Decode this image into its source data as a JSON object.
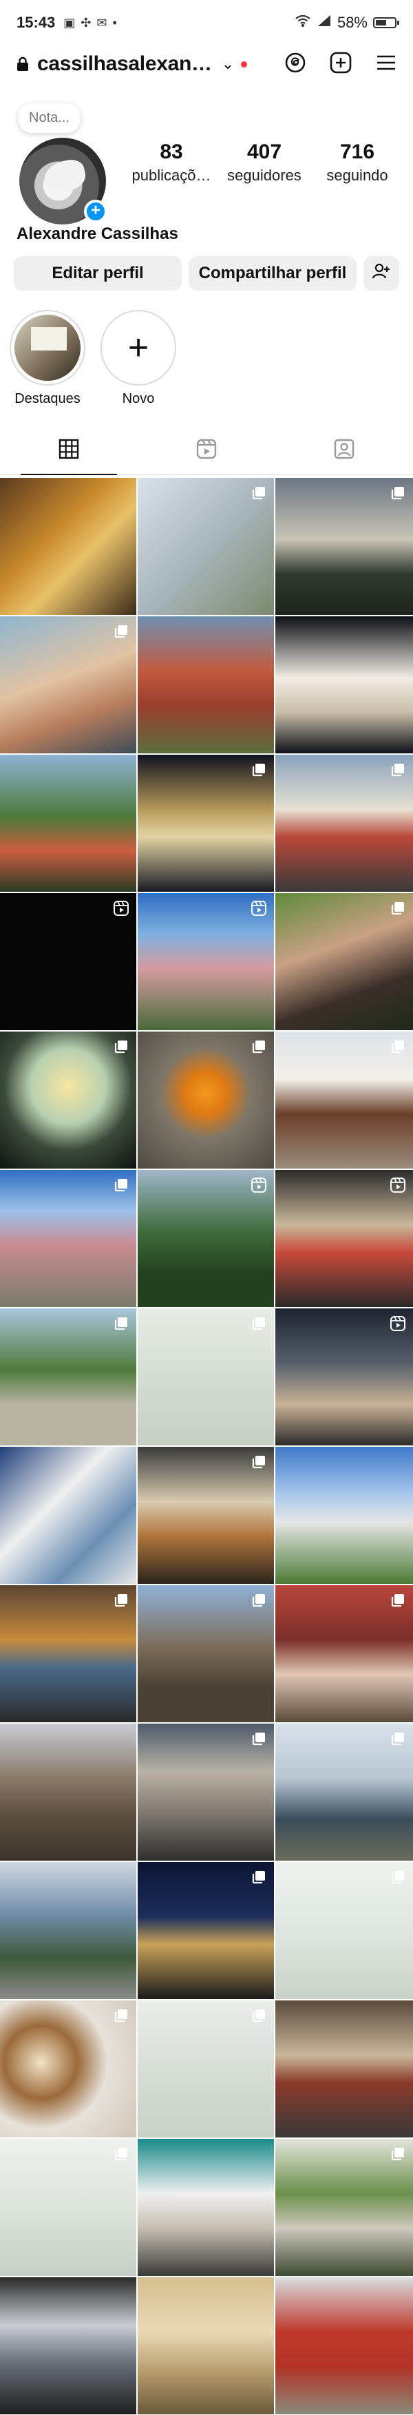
{
  "status_bar": {
    "time": "15:43",
    "battery": "58%",
    "battery_level": 0.58
  },
  "header": {
    "username": "cassilhasalexan…"
  },
  "profile": {
    "note_placeholder": "Nota...",
    "posts_count": "83",
    "posts_label": "publicaçõ…",
    "followers_count": "407",
    "followers_label": "seguidores",
    "following_count": "716",
    "following_label": "seguindo",
    "full_name": "Alexandre Cassilhas",
    "edit_button": "Editar perfil",
    "share_button": "Compartilhar perfil"
  },
  "highlights": [
    {
      "label": "Destaques"
    },
    {
      "label": "Novo"
    }
  ],
  "tabs": [
    "grid",
    "reels",
    "tagged"
  ],
  "grid_posts": [
    {
      "bg": "linear-gradient(135deg,#5b3a1f,#c98a2c 40%,#e9c16a 60%,#3b2a18)",
      "badge": "none"
    },
    {
      "bg": "linear-gradient(135deg,#d9e2e8,#a9b6bd 50%,#7c8a6e)",
      "badge": "multi"
    },
    {
      "bg": "linear-gradient(180deg,#6b7784,#c9c4b5 45%,#2f3a2e 70%,#1d241d)",
      "badge": "multi"
    },
    {
      "bg": "linear-gradient(160deg,#8fb6d0,#e2c3a3 45%,#b77d5c 70%,#3d4b58)",
      "badge": "multi"
    },
    {
      "bg": "linear-gradient(180deg,#6f8fb0,#c25a3e 40%,#9a3d2d 65%,#5c6e3f)",
      "badge": "none"
    },
    {
      "bg": "linear-gradient(180deg,#0d0f16,#f2ede4 45%,#c9bda9 70%,#0e1118)",
      "badge": "none"
    },
    {
      "bg": "linear-gradient(180deg,#8fb2d4,#4c7a3a 45%,#cc5e40 70%,#2b3b23)",
      "badge": "none"
    },
    {
      "bg": "linear-gradient(180deg,#121320,#b79a5a 40%,#e2d3a4 60%,#191a24)",
      "badge": "multi"
    },
    {
      "bg": "linear-gradient(180deg,#8aa3bd,#e7e0d2 40%,#b9483a 60%,#3a3a3a)",
      "badge": "multi"
    },
    {
      "bg": "#050505",
      "badge": "reel"
    },
    {
      "bg": "linear-gradient(180deg,#2f6fc2,#7fb0e0 30%,#d49ba0 55%,#4a6a3a)",
      "badge": "reel"
    },
    {
      "bg": "linear-gradient(160deg,#5f8a3b,#c9a184 40%,#3b2e29 70%,#1e2a1a)",
      "badge": "multi"
    },
    {
      "bg": "radial-gradient(circle at 50% 40%,#f7e6a2,#b8d0b0 35%,#3b4a3a 60%,#0f1410)",
      "badge": "multi"
    },
    {
      "bg": "radial-gradient(circle at 50% 45%,#f39a1f,#e07a12 20%,#7d7669 45%,#4e4a42)",
      "badge": "multi"
    },
    {
      "bg": "linear-gradient(180deg,#dde4ea,#f3efe8 35%,#6b3f2a 60%,#9a8c7a)",
      "badge": "multi"
    },
    {
      "bg": "linear-gradient(180deg,#2f6fc2,#9dc1e8 30%,#c98b93 55%,#7a7a6a)",
      "badge": "multi"
    },
    {
      "bg": "linear-gradient(180deg,#9fb6c9,#3e6b3b 45%,#25421f 75%)",
      "badge": "reel"
    },
    {
      "bg": "linear-gradient(180deg,#2b2b2b,#c9b79a 40%,#c94a3a 60%,#2a2a2a)",
      "badge": "reel"
    },
    {
      "bg": "linear-gradient(180deg,#a9c6dd,#4e7a3a 45%,#b9b3a3 70%)",
      "badge": "multi"
    },
    {
      "bg": "linear-gradient(180deg,#e8ece6,#d4ddd3 50%,#c7cfc3)",
      "badge": "multi"
    },
    {
      "bg": "linear-gradient(180deg,#1e2430,#56606d 40%,#c9b295 70%,#2c2c2c)",
      "badge": "reel"
    },
    {
      "bg": "linear-gradient(135deg,#1f3f7a,#f0f0f0 40%,#6a8fb5 70%,#e8e8e8)",
      "badge": "none"
    },
    {
      "bg": "linear-gradient(180deg,#3a3a3a,#d8cbb0 40%,#b0763b 65%,#2b241d)",
      "badge": "multi"
    },
    {
      "bg": "linear-gradient(180deg,#3f79c9,#a9c8ec 35%,#e6e6e6 55%,#4c7a34)",
      "badge": "none"
    },
    {
      "bg": "linear-gradient(180deg,#5b4634,#c78a3c 40%,#4a6a8a 60%,#2a2a2a)",
      "badge": "multi"
    },
    {
      "bg": "linear-gradient(180deg,#8fb1d6,#7c6d5a 45%,#4a4034 75%)",
      "badge": "multi"
    },
    {
      "bg": "linear-gradient(180deg,#b9463b,#7b2f2a 40%,#e1c8b4 65%,#5a4a3a)",
      "badge": "multi"
    },
    {
      "bg": "linear-gradient(180deg,#c7ccd2,#8b7a6a 40%,#5f5142 65%,#3b342b)",
      "badge": "none"
    },
    {
      "bg": "linear-gradient(180deg,#4d5b6a,#b9b2a5 35%,#8a8278 60%,#2f2f2f)",
      "badge": "multi"
    },
    {
      "bg": "linear-gradient(180deg,#d8e1ea,#b8c6d2 40%,#3b4d5a 70%,#6a6a5a)",
      "badge": "multi"
    },
    {
      "bg": "linear-gradient(180deg,#cfd8e2,#6d8aa6 40%,#3f5a3a 70%,#8b8b8b)",
      "badge": "none"
    },
    {
      "bg": "linear-gradient(180deg,#0b1433,#1c2e5a 40%,#c9a258 60%,#1b1b1b)",
      "badge": "multi"
    },
    {
      "bg": "linear-gradient(180deg,#eef2ee,#dfe6df 50%,#c9d2c9)",
      "badge": "multi"
    },
    {
      "bg": "radial-gradient(circle at 30% 45%,#f2e3c6,#9b6a3a 30%,#e7e2da 55%,#cfc6b8)",
      "badge": "multi"
    },
    {
      "bg": "linear-gradient(180deg,#e9eee9,#d7ded6 50%,#c9d1c8)",
      "badge": "multi"
    },
    {
      "bg": "linear-gradient(180deg,#5a4a3a,#c9b79a 40%,#8b3a2a 60%,#3a3a3a)",
      "badge": "none"
    },
    {
      "bg": "linear-gradient(180deg,#eef2ee,#dde4dc 50%,#c6cfc5)",
      "badge": "multi"
    },
    {
      "bg": "linear-gradient(180deg,#1a8a8a,#f0f0f0 40%,#c7c0b2 65%,#3a3a3a)",
      "badge": "none"
    },
    {
      "bg": "linear-gradient(180deg,#e3e6dc,#6b8f4a 40%,#cfc9bd 65%,#3d4a33)",
      "badge": "multi"
    },
    {
      "bg": "linear-gradient(180deg,#2a2a2a,#c9cdd3 35%,#6e7680 60%,#1e1e1e)",
      "badge": "none"
    },
    {
      "bg": "linear-gradient(180deg,#d6bf8f,#e8d9b5 40%,#b49a6a 70%,#6b5a3a)",
      "badge": "none"
    },
    {
      "bg": "linear-gradient(180deg,#d9dde0,#c0392b 40%,#b33226 65%,#8a8a7a)",
      "badge": "none"
    }
  ],
  "colors": {
    "accent_blue": "#0095f6",
    "notification_red": "#ff3040",
    "button_bg": "#efefef"
  }
}
